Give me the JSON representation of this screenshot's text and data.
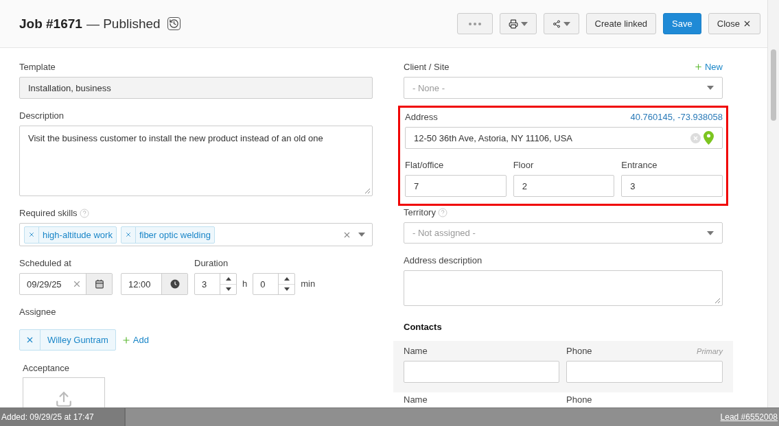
{
  "header": {
    "title": "Job #1671",
    "status": "— Published",
    "buttons": [
      {
        "kind": "more"
      },
      {
        "kind": "print"
      },
      {
        "kind": "share"
      },
      {
        "kind": "text",
        "label": "Create linked",
        "primary": false
      },
      {
        "kind": "text",
        "label": "Save",
        "primary": true
      },
      {
        "kind": "close",
        "label": "Close",
        "primary": false
      }
    ]
  },
  "left": {
    "template": {
      "label": "Template",
      "value": "Installation, business"
    },
    "description": {
      "label": "Description",
      "value": "Visit the business customer to install the new product instead of an old one"
    },
    "required_skills": {
      "label": "Required skills",
      "tags": [
        "high-altitude work",
        "fiber optic welding"
      ]
    },
    "scheduled": {
      "label": "Scheduled at",
      "date": "09/29/25",
      "time": "12:00"
    },
    "duration": {
      "label": "Duration",
      "hours": "3",
      "hours_unit": "h",
      "minutes": "0",
      "minutes_unit": "min"
    },
    "assignee": {
      "label": "Assignee",
      "chips": [
        "Willey Guntram"
      ],
      "add": "Add"
    },
    "acceptance": {
      "label": "Acceptance"
    }
  },
  "right": {
    "client_site": {
      "label": "Client / Site",
      "new_link": "New",
      "placeholder": "- None -"
    },
    "address": {
      "label": "Address",
      "coordinates": "40.760145, -73.938058",
      "value": "12-50 36th Ave, Astoria, NY 11106, USA",
      "highlighted": true,
      "sub_fields": [
        {
          "label": "Flat/office",
          "value": "7"
        },
        {
          "label": "Floor",
          "value": "2"
        },
        {
          "label": "Entrance",
          "value": "3"
        }
      ]
    },
    "territory": {
      "label": "Territory",
      "placeholder": "- Not assigned -"
    },
    "address_description": {
      "label": "Address description"
    },
    "contacts": {
      "title": "Contacts",
      "rows": [
        {
          "name_label": "Name",
          "phone_label": "Phone",
          "primary_label": "Primary"
        },
        {
          "name_label": "Name",
          "phone_label": "Phone"
        }
      ]
    }
  },
  "background": {
    "footer_left": "Added: 09/29/25 at 17:47",
    "footer_right": "Lead #6552008"
  }
}
